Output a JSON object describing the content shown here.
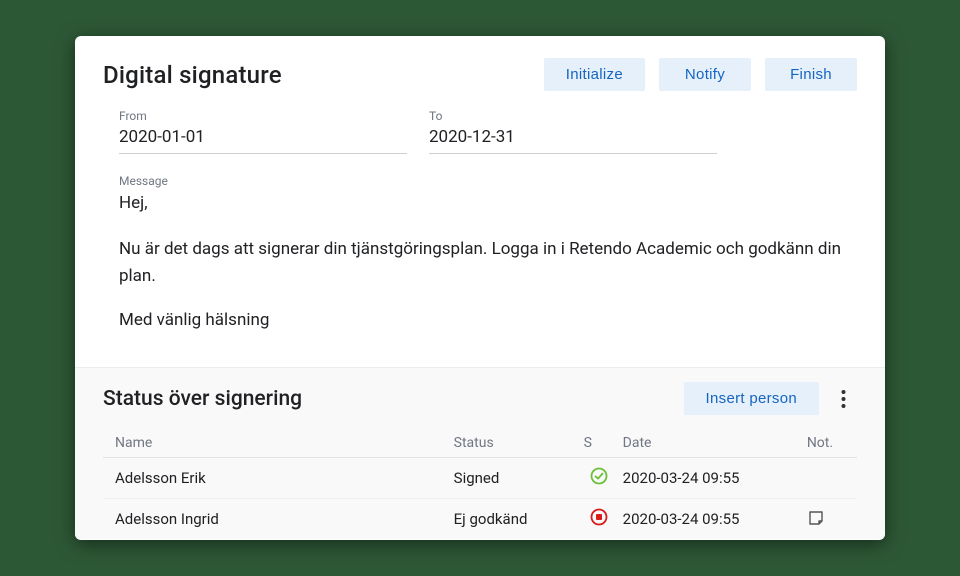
{
  "header": {
    "title": "Digital signature",
    "buttons": {
      "initialize": "Initialize",
      "notify": "Notify",
      "finish": "Finish"
    }
  },
  "dates": {
    "from_label": "From",
    "from_value": "2020-01-01",
    "to_label": "To",
    "to_value": "2020-12-31"
  },
  "message": {
    "label": "Message",
    "line1": "Hej,",
    "line2": "Nu är det dags att signerar din tjänstgöringsplan. Logga in i Retendo Academic och godkänn din plan.",
    "line3": "Med vänlig hälsning"
  },
  "status": {
    "title": "Status över signering",
    "insert_label": "Insert person",
    "columns": {
      "name": "Name",
      "status": "Status",
      "s": "S",
      "date": "Date",
      "not": "Not."
    },
    "rows": [
      {
        "name": "Adelsson Erik",
        "status": "Signed",
        "s_icon": "approved",
        "date": "2020-03-24 09:55",
        "note": false
      },
      {
        "name": "Adelsson Ingrid",
        "status": "Ej godkänd",
        "s_icon": "rejected",
        "date": "2020-03-24 09:55",
        "note": true
      }
    ]
  }
}
